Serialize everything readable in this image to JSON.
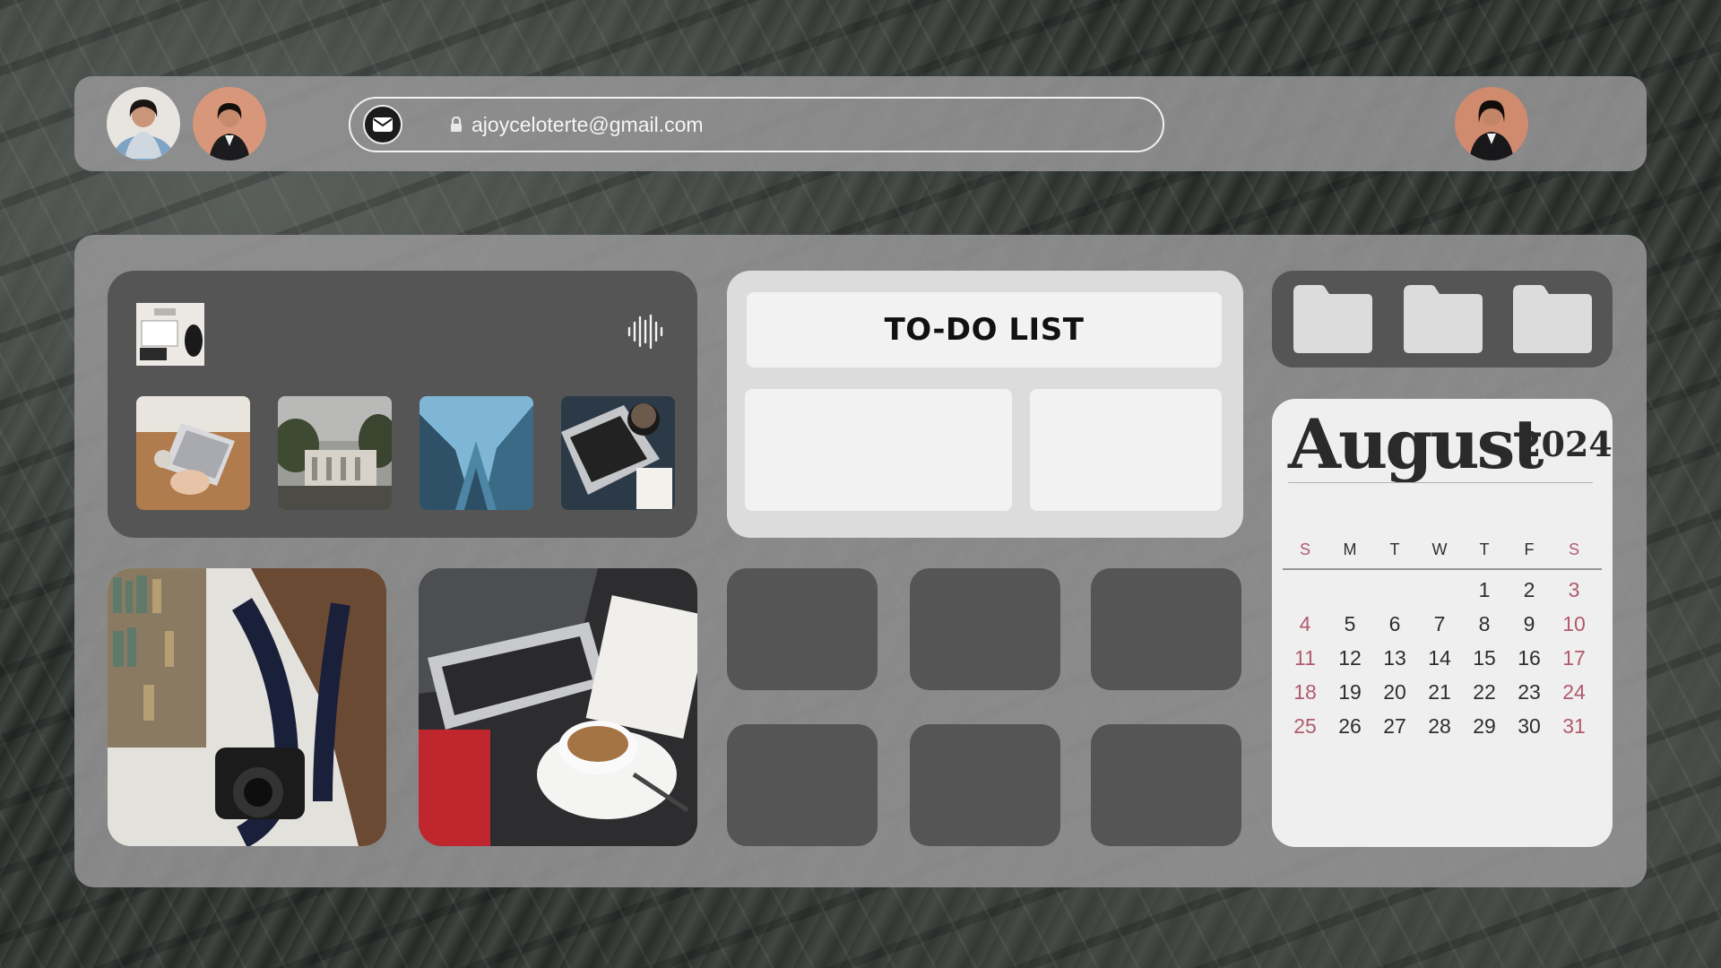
{
  "topbar": {
    "avatars": [
      "avatar-saree",
      "avatar-blazer",
      "avatar-profile"
    ],
    "email": "ajoyceloterte@gmail.com",
    "mail_icon": "mail-icon",
    "lock_icon": "lock-icon"
  },
  "media_panel": {
    "wave_icon": "sound-wave-icon",
    "gallery": [
      "laptop-on-desk",
      "palace-building",
      "glass-skyscrapers",
      "laptop-and-coffee-cup"
    ]
  },
  "photos": [
    "camera-in-library",
    "laptop-and-espresso"
  ],
  "todo": {
    "title": "TO-DO LIST"
  },
  "folders": [
    "folder-icon",
    "folder-icon",
    "folder-icon"
  ],
  "calendar": {
    "month": "August",
    "year": "2024",
    "weekdays": [
      "S",
      "M",
      "T",
      "W",
      "T",
      "F",
      "S"
    ],
    "weeks": [
      [
        "",
        "",
        "",
        "",
        "1",
        "2",
        "3"
      ],
      [
        "4",
        "5",
        "6",
        "7",
        "8",
        "9",
        "10"
      ],
      [
        "11",
        "12",
        "13",
        "14",
        "15",
        "16",
        "17"
      ],
      [
        "18",
        "19",
        "20",
        "21",
        "22",
        "23",
        "24"
      ],
      [
        "25",
        "26",
        "27",
        "28",
        "29",
        "30",
        "31"
      ]
    ],
    "weekend_color": "#b05a70"
  }
}
